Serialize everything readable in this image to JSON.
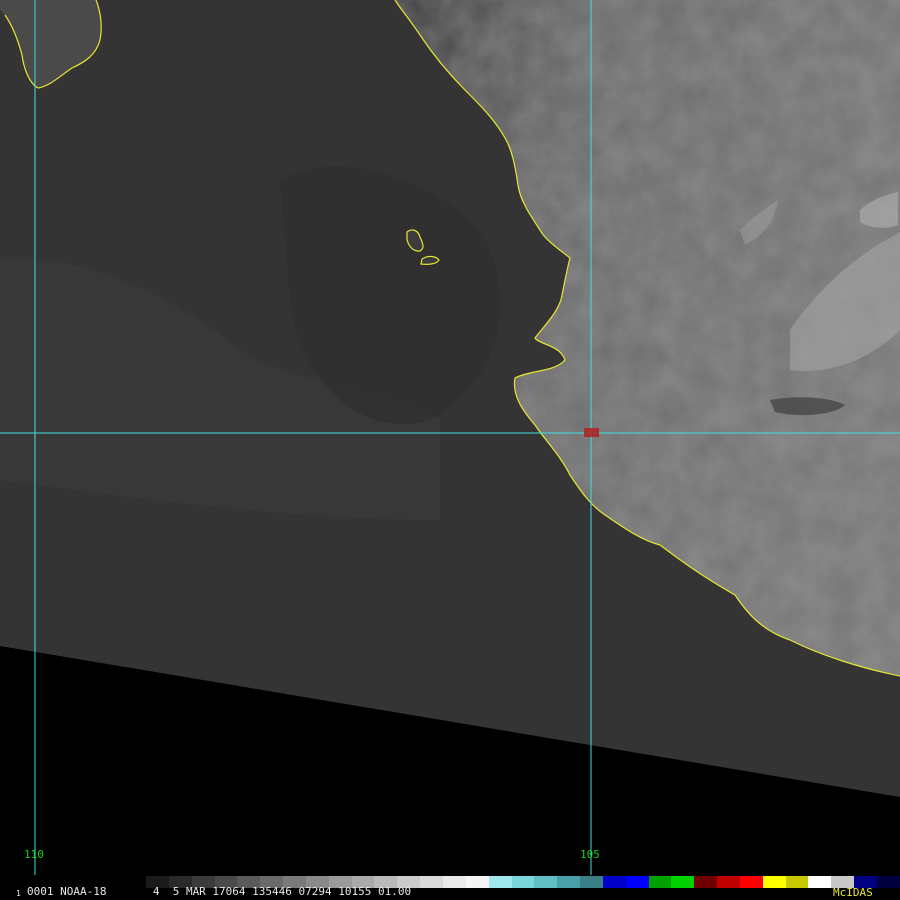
{
  "image": {
    "satellite": "NOAA-18",
    "frame_number": "0001",
    "frame_index": "1",
    "band": "4",
    "date": "5 MAR 17064",
    "time": "135446",
    "extra_fields": "07294 10155 01.00",
    "software": "McIDAS"
  },
  "status_line": "0001 NOAA-18       4  5 MAR 17064 135446 07294 10155 01.00",
  "longitude_labels": [
    "110",
    "105"
  ],
  "colors": {
    "coastline": "#e6e633",
    "gridline": "#3fe0e0",
    "label_green": "#19d219",
    "ocean": "#333333",
    "land": "#5a5a5a",
    "no_data": "#000000",
    "marker": "#b02020"
  },
  "colorbar": [
    "#1a1a1a",
    "#2a2a2a",
    "#3a3a3a",
    "#4a4a4a",
    "#5a5a5a",
    "#6a6a6a",
    "#7a7a7a",
    "#8a8a8a",
    "#9a9a9a",
    "#aaaaaa",
    "#bababa",
    "#cacaca",
    "#dadada",
    "#eaeaea",
    "#f4f4f4",
    "#9fe8f0",
    "#7ad6da",
    "#5fbfc2",
    "#4aa0a8",
    "#3a7f88",
    "#0000c8",
    "#0000ff",
    "#00a000",
    "#00d200",
    "#700000",
    "#c00000",
    "#ff0000",
    "#ffff00",
    "#c8c800",
    "#ffffff",
    "#c8c8c8",
    "#000080",
    "#000040"
  ]
}
